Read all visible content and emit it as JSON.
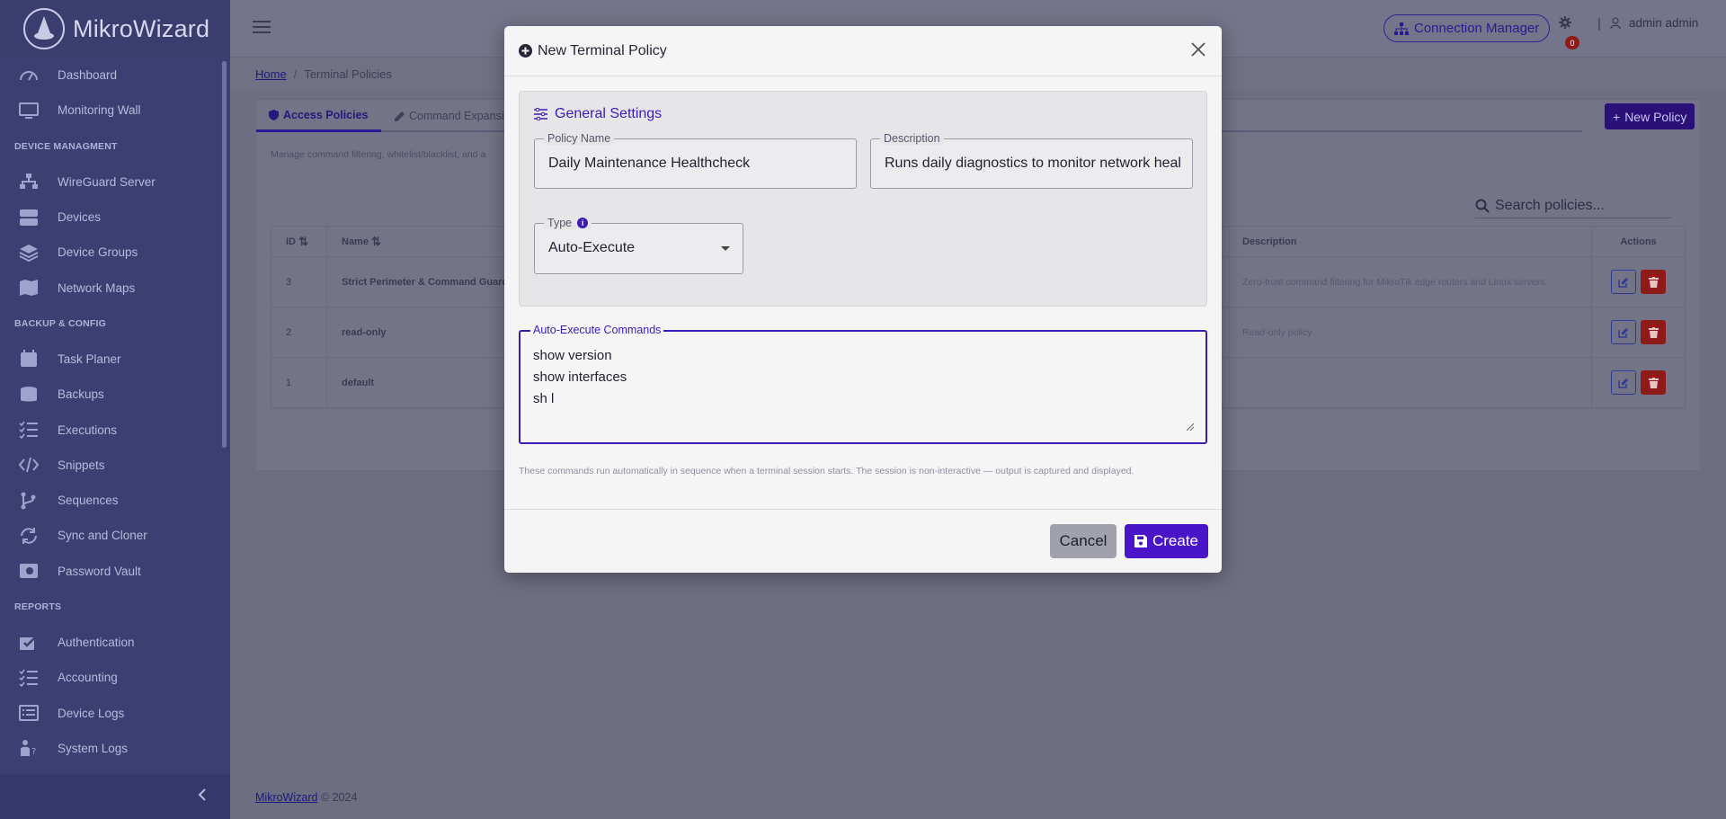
{
  "brand": {
    "name": "MikroWizard"
  },
  "sidebar": {
    "items": [
      {
        "label": "Dashboard",
        "icon": "speedometer-icon"
      },
      {
        "label": "Monitoring Wall",
        "icon": "monitor-icon"
      },
      {
        "section": "DEVICE MANAGMENT"
      },
      {
        "label": "WireGuard Server",
        "icon": "network-icon"
      },
      {
        "label": "Devices",
        "icon": "server-icon"
      },
      {
        "label": "Device Groups",
        "icon": "layers-icon"
      },
      {
        "label": "Network Maps",
        "icon": "map-icon"
      },
      {
        "section": "BACKUP & CONFIG"
      },
      {
        "label": "Task Planer",
        "icon": "calendar-icon"
      },
      {
        "label": "Backups",
        "icon": "database-icon"
      },
      {
        "label": "Executions",
        "icon": "list-check-icon"
      },
      {
        "label": "Snippets",
        "icon": "code-icon"
      },
      {
        "label": "Sequences",
        "icon": "branch-icon"
      },
      {
        "label": "Sync and Cloner",
        "icon": "sync-icon"
      },
      {
        "label": "Password Vault",
        "icon": "vault-icon"
      },
      {
        "section": "REPORTS"
      },
      {
        "label": "Authentication",
        "icon": "auth-check-icon"
      },
      {
        "label": "Accounting",
        "icon": "list-check-icon"
      },
      {
        "label": "Device Logs",
        "icon": "list-icon"
      },
      {
        "label": "System Logs",
        "icon": "person-question-icon"
      }
    ]
  },
  "topbar": {
    "connection_manager": "Connection Manager",
    "notification_count": "0",
    "user": "admin admin"
  },
  "breadcrumb": {
    "home": "Home",
    "current": "Terminal Policies"
  },
  "page": {
    "tabs": [
      {
        "label": "Access Policies",
        "active": true
      },
      {
        "label": "Command Expansi"
      }
    ],
    "new_policy": "New Policy",
    "description": "Manage command filtering, whitelist/blacklist, and a",
    "search_placeholder": "Search policies...",
    "table": {
      "headers": {
        "id": "ID",
        "name": "Name",
        "description": "Description",
        "actions": "Actions"
      },
      "rows": [
        {
          "id": "3",
          "name": "Strict Perimeter & Command Guard",
          "description": "Zero-trust command filtering for MikroTik edge routers and Linux servers."
        },
        {
          "id": "2",
          "name": "read-only",
          "description": "Read-only policy"
        },
        {
          "id": "1",
          "name": "default",
          "description": ""
        }
      ]
    }
  },
  "footer": {
    "link": "MikroWizard",
    "text": "© 2024"
  },
  "modal": {
    "title": "New Terminal Policy",
    "general_settings": "General Settings",
    "policy_name": {
      "label": "Policy Name",
      "value": "Daily Maintenance Healthcheck"
    },
    "description": {
      "label": "Description",
      "value": "Runs daily diagnostics to monitor network health"
    },
    "type": {
      "label": "Type",
      "value": "Auto-Execute",
      "info": "i"
    },
    "commands": {
      "label": "Auto-Execute Commands",
      "value": "show version\nshow interfaces\nsh l"
    },
    "hint": "These commands run automatically in sequence when a terminal session starts. The session is non-interactive — output is captured and displayed.",
    "cancel": "Cancel",
    "create": "Create"
  },
  "colors": {
    "accent": "#4a14c8",
    "sidebar": "#3c3f72",
    "danger": "#8f1a1a"
  }
}
